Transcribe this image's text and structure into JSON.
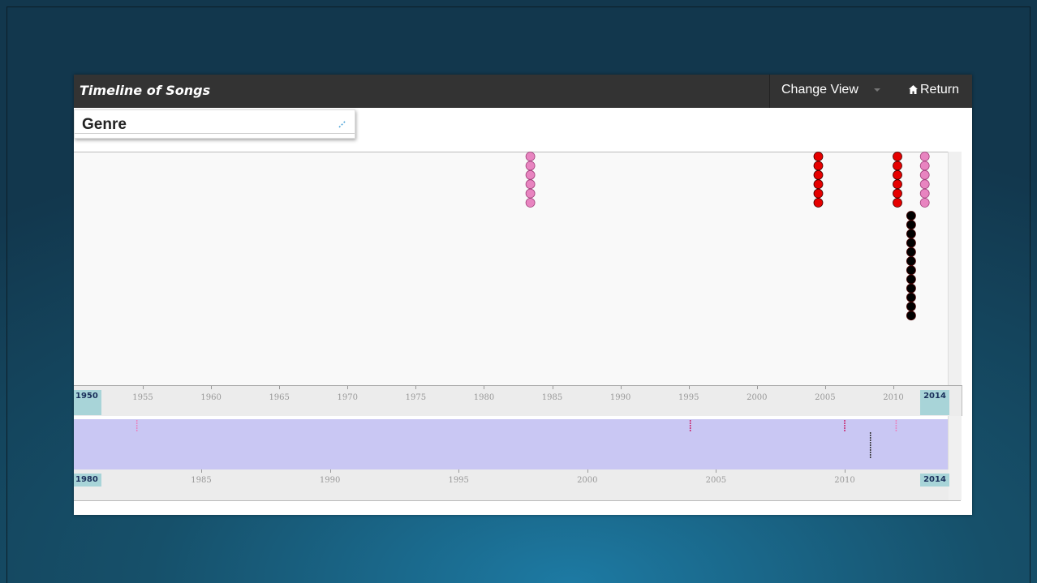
{
  "app": {
    "title": "Timeline of Songs",
    "change_view_label": "Change View",
    "return_label": "Return",
    "genre_label": "Genre"
  },
  "timeline": {
    "axis_ticks": [
      "1955",
      "1960",
      "1965",
      "1970",
      "1975",
      "1980",
      "1985",
      "1990",
      "1995",
      "2000",
      "2005",
      "2010"
    ],
    "range_start": "1950",
    "range_end": "2014",
    "overview_ticks": [
      "1985",
      "1990",
      "1995",
      "2000",
      "2005",
      "2010"
    ],
    "overview_start": "1980",
    "overview_end": "2014"
  },
  "chart_data": {
    "type": "scatter",
    "xlim": [
      1950,
      2014
    ],
    "series": [
      {
        "color": "#e884c0",
        "x": 1983.4,
        "count": 6
      },
      {
        "color": "#e60000",
        "x": 2004.5,
        "count": 6
      },
      {
        "color": "#e60000",
        "x": 2010.3,
        "count": 6
      },
      {
        "color": "#e884c0",
        "x": 2012.3,
        "count": 6
      },
      {
        "color": "#000000",
        "x": 2011.3,
        "count": 12
      }
    ],
    "overview": {
      "xlim": [
        1980,
        2014
      ],
      "marks": [
        {
          "x": 1982.5,
          "color": "#e884c0"
        },
        {
          "x": 2004.0,
          "color": "#c8206a"
        },
        {
          "x": 2010.0,
          "color": "#c8206a"
        },
        {
          "x": 2012.0,
          "color": "#e884c0"
        },
        {
          "x": 2011.0,
          "color": "#333333"
        }
      ]
    }
  }
}
